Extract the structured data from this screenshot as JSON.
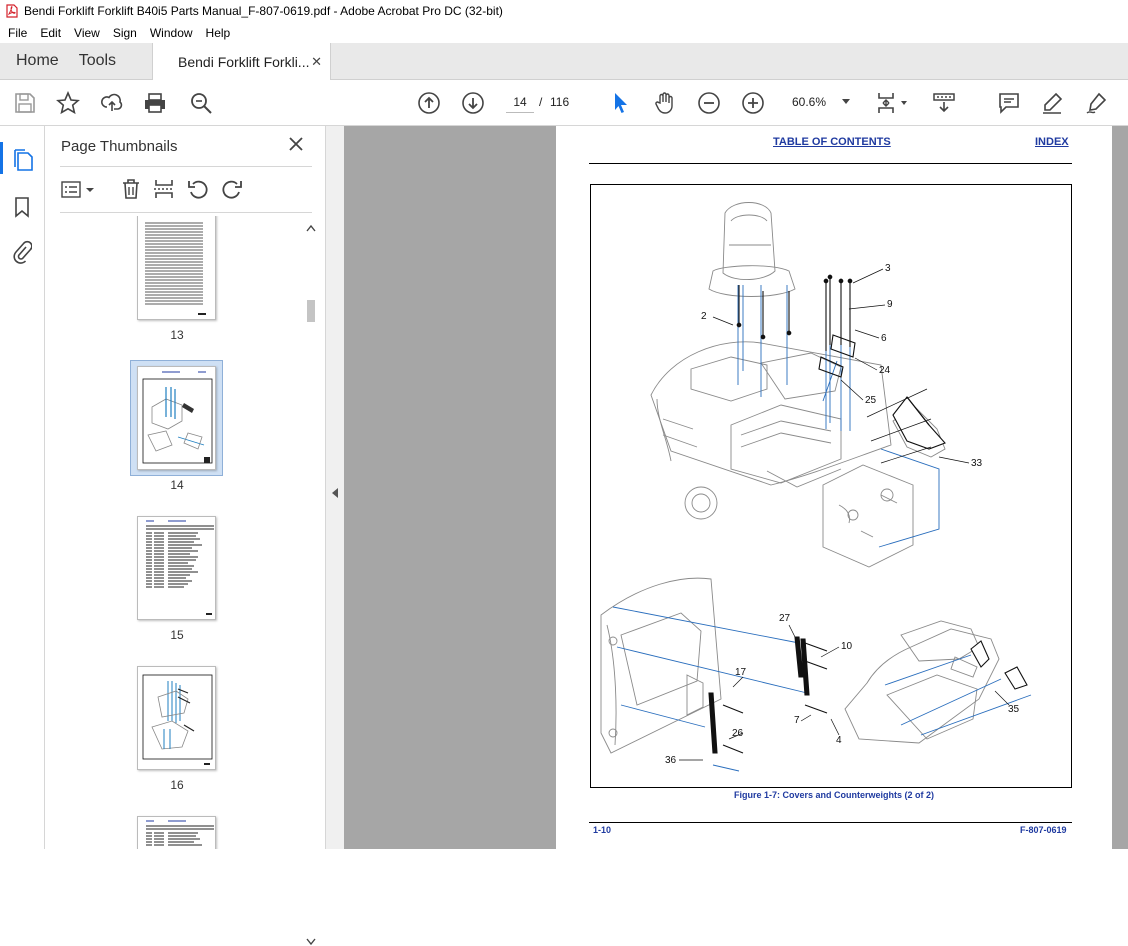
{
  "window": {
    "title": "Bendi Forklift Forklift B40i5 Parts Manual_F-807-0619.pdf - Adobe Acrobat Pro DC (32-bit)"
  },
  "menu": [
    "File",
    "Edit",
    "View",
    "Sign",
    "Window",
    "Help"
  ],
  "tabs": {
    "home": "Home",
    "tools": "Tools",
    "document": "Bendi Forklift Forkli..."
  },
  "navigation": {
    "current_page": "14",
    "separator": "/",
    "total_pages": "116",
    "zoom": "60.6%"
  },
  "sidebar": {
    "title": "Page Thumbnails",
    "thumbnails": [
      {
        "number": "13",
        "selected": false
      },
      {
        "number": "14",
        "selected": true
      },
      {
        "number": "15",
        "selected": false
      },
      {
        "number": "16",
        "selected": false
      }
    ]
  },
  "document": {
    "header_left": "TABLE OF CONTENTS",
    "header_right": "INDEX",
    "callouts": [
      "3",
      "9",
      "2",
      "6",
      "24",
      "25",
      "33",
      "27",
      "10",
      "17",
      "7",
      "4",
      "26",
      "36",
      "35"
    ],
    "caption": "Figure 1-7:  Covers and Counterweights (2 of 2)",
    "footer_left": "1-10",
    "footer_right": "F-807-0619"
  },
  "colors": {
    "link_blue": "#1f3aa0",
    "accent": "#1473e6",
    "leader_blue": "#2a6ebd"
  }
}
